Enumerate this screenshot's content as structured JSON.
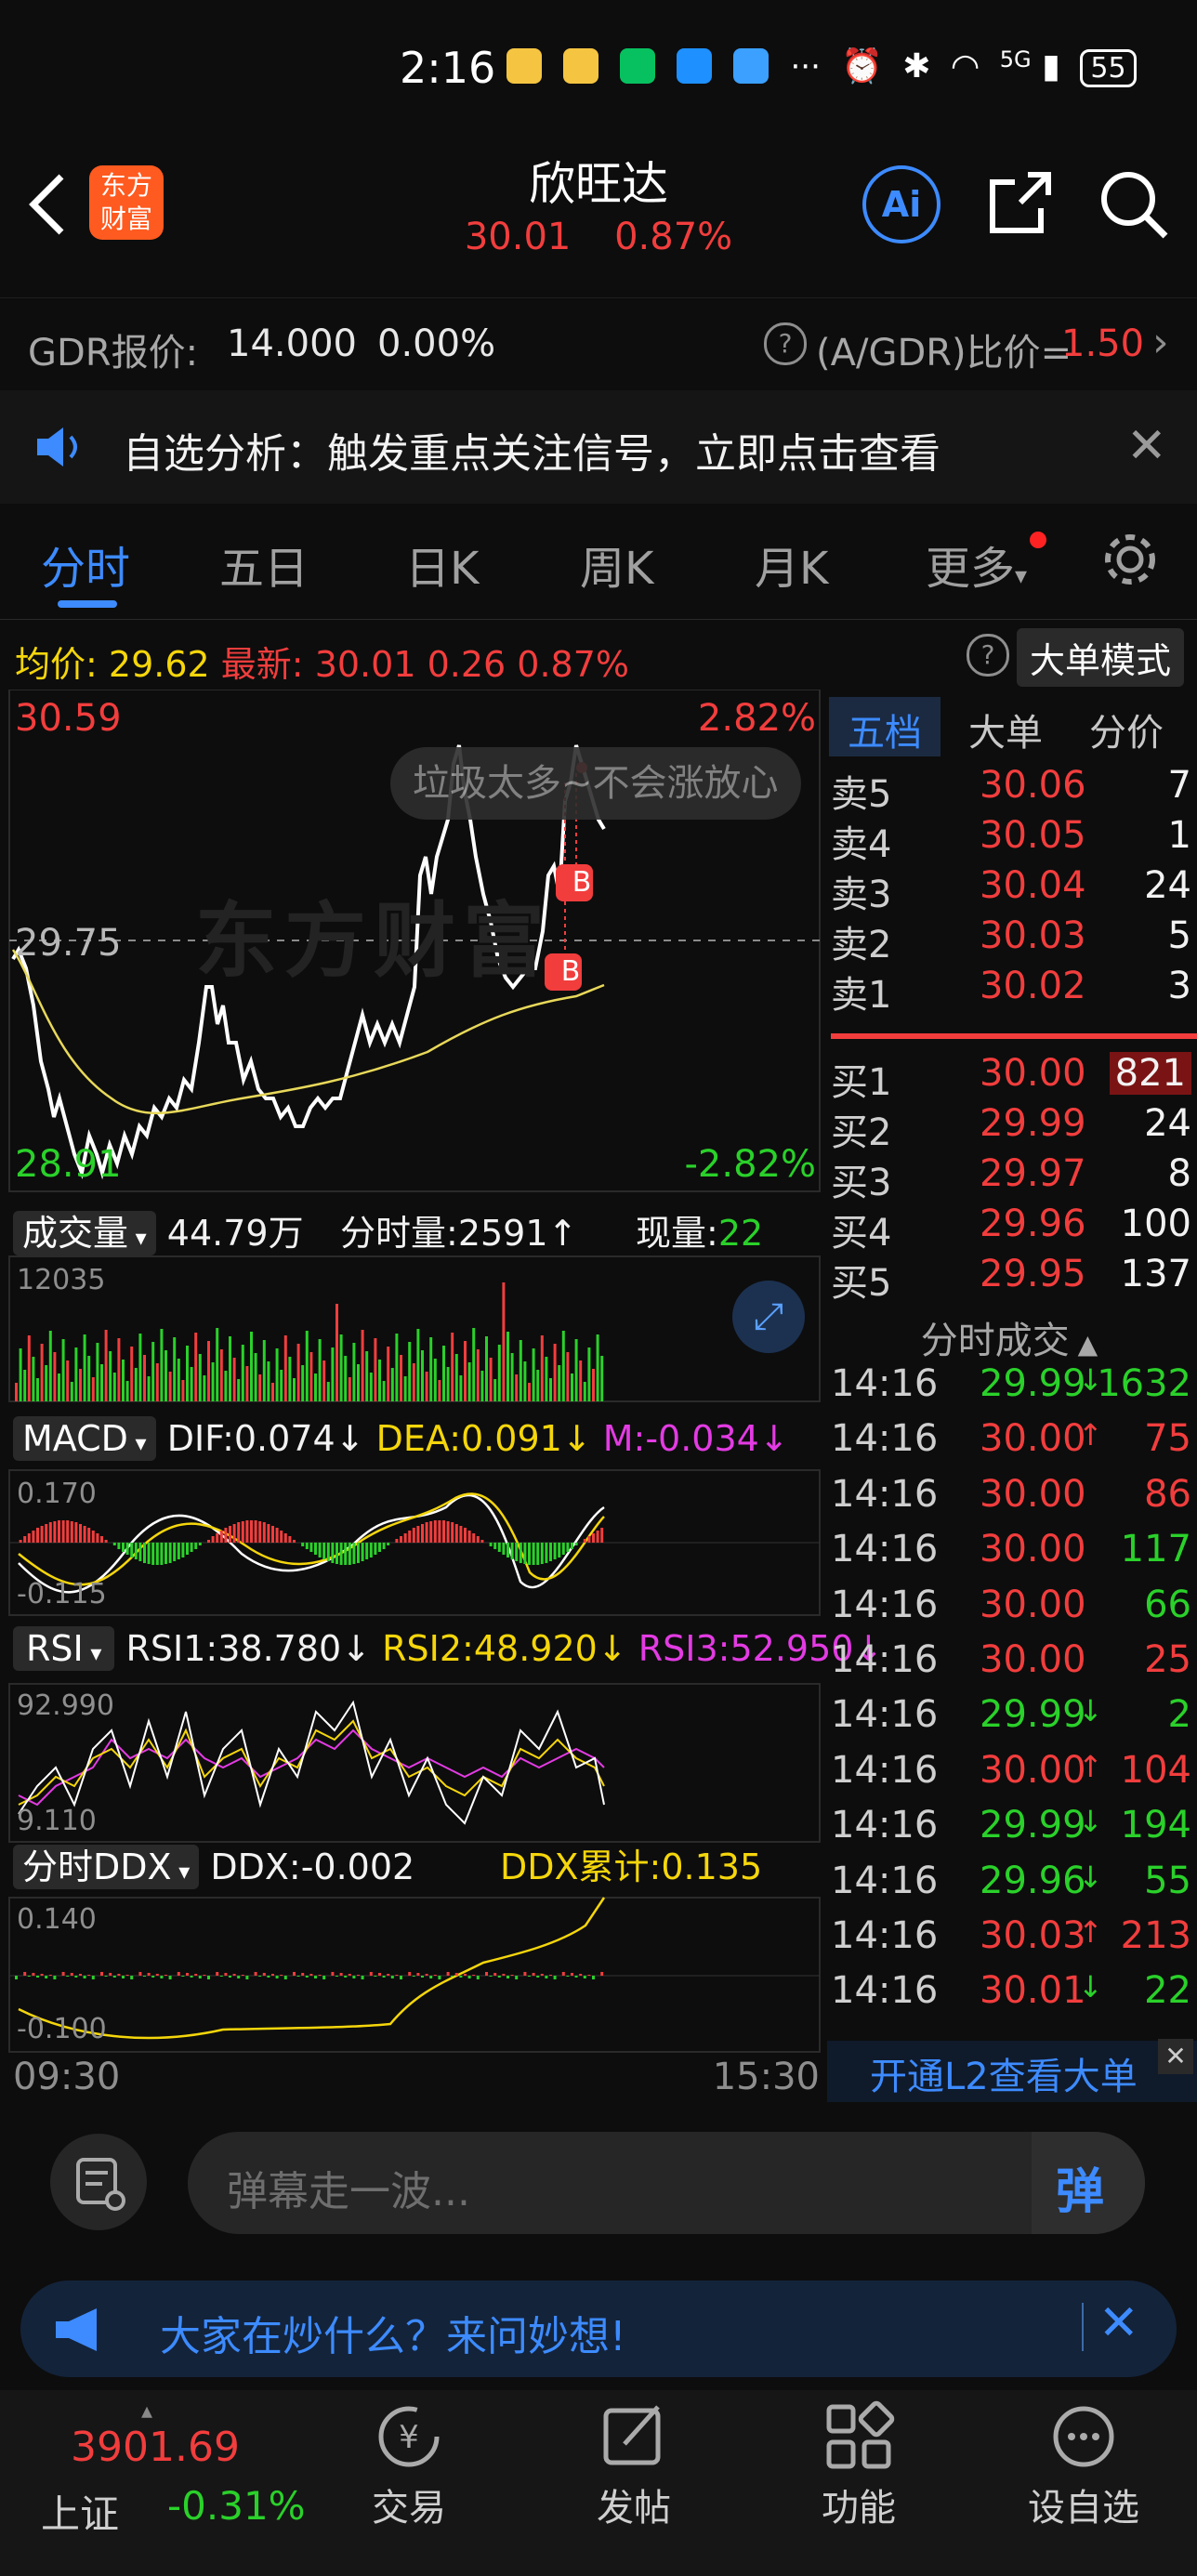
{
  "status_bar": {
    "time": "2:16",
    "more": "···",
    "signal": "5G",
    "battery": "55"
  },
  "header": {
    "logo_line1": "东方",
    "logo_line2": "财富",
    "title": "欣旺达",
    "price": "30.01",
    "change_pct": "0.87%"
  },
  "gdr": {
    "label": "GDR报价:",
    "price": "14.000",
    "pct": "0.00%",
    "ratio_label": "(A/GDR)比价=",
    "ratio_value": "1.50"
  },
  "notice": {
    "text": "自选分析：触发重点关注信号，立即点击查看"
  },
  "tabs": [
    "分时",
    "五日",
    "日K",
    "周K",
    "月K",
    "更多"
  ],
  "info": {
    "avg_label": "均价:",
    "avg_value": "29.62",
    "latest_label": "最新:",
    "latest_value": "30.01",
    "change": "0.26",
    "pct": "0.87%",
    "mode_button": "大单模式"
  },
  "price_chart": {
    "high": "30.59",
    "high_pct": "2.82%",
    "mid": "29.75",
    "low": "28.91",
    "low_pct": "-2.82%",
    "watermark": "东方财富",
    "bubble": "垃圾太多~不会涨放心",
    "markers": [
      "B",
      "B"
    ]
  },
  "volume": {
    "selector": "成交量",
    "total": "44.79万",
    "minute_label": "分时量:",
    "minute_value": "2591",
    "now_label": "现量:",
    "now_value": "22",
    "max": "12035"
  },
  "macd": {
    "selector": "MACD",
    "dif": "DIF:0.074",
    "dea": "DEA:0.091",
    "m": "M:-0.034",
    "top": "0.170",
    "bottom": "-0.115"
  },
  "rsi": {
    "selector": "RSI",
    "rsi1": "RSI1:38.780",
    "rsi2": "RSI2:48.920",
    "rsi3": "RSI3:52.950",
    "top": "92.990",
    "bottom": "9.110"
  },
  "ddx": {
    "selector": "分时DDX",
    "ddx": "DDX:-0.002",
    "cum": "DDX累计:0.135",
    "top": "0.140",
    "bottom": "-0.100"
  },
  "time_axis": {
    "start": "09:30",
    "end": "15:30"
  },
  "side_tabs": [
    "五档",
    "大单",
    "分价"
  ],
  "asks": [
    {
      "label": "卖5",
      "price": "30.06",
      "vol": "7"
    },
    {
      "label": "卖4",
      "price": "30.05",
      "vol": "1"
    },
    {
      "label": "卖3",
      "price": "30.04",
      "vol": "24"
    },
    {
      "label": "卖2",
      "price": "30.03",
      "vol": "5"
    },
    {
      "label": "卖1",
      "price": "30.02",
      "vol": "3"
    }
  ],
  "bids": [
    {
      "label": "买1",
      "price": "30.00",
      "vol": "821"
    },
    {
      "label": "买2",
      "price": "29.99",
      "vol": "24"
    },
    {
      "label": "买3",
      "price": "29.97",
      "vol": "8"
    },
    {
      "label": "买4",
      "price": "29.96",
      "vol": "100"
    },
    {
      "label": "买5",
      "price": "29.95",
      "vol": "137"
    }
  ],
  "trades_title": "分时成交",
  "trades": [
    {
      "time": "14:16",
      "price": "29.99",
      "dir": "down",
      "vol": "1632"
    },
    {
      "time": "14:16",
      "price": "30.00",
      "dir": "up",
      "vol": "75"
    },
    {
      "time": "14:16",
      "price": "30.00",
      "dir": "none",
      "vol": "86"
    },
    {
      "time": "14:16",
      "price": "30.00",
      "dir": "none",
      "vol": "117"
    },
    {
      "time": "14:16",
      "price": "30.00",
      "dir": "none",
      "vol": "66"
    },
    {
      "time": "14:16",
      "price": "30.00",
      "dir": "none",
      "vol": "25"
    },
    {
      "time": "14:16",
      "price": "29.99",
      "dir": "down",
      "vol": "2"
    },
    {
      "time": "14:16",
      "price": "30.00",
      "dir": "up",
      "vol": "104"
    },
    {
      "time": "14:16",
      "price": "29.99",
      "dir": "down",
      "vol": "194"
    },
    {
      "time": "14:16",
      "price": "29.96",
      "dir": "down",
      "vol": "55"
    },
    {
      "time": "14:16",
      "price": "30.03",
      "dir": "up",
      "vol": "213"
    },
    {
      "time": "14:16",
      "price": "30.01",
      "dir": "down",
      "vol": "22"
    }
  ],
  "l2_banner": "开通L2查看大单",
  "danmu": {
    "placeholder": "弹幕走一波...",
    "send": "弹"
  },
  "ask_banner": {
    "text": "大家在炒什么？来问妙想!"
  },
  "bottom_nav": {
    "index_value": "3901.69",
    "index_name": "上证",
    "index_pct": "-0.31%",
    "items": [
      "交易",
      "发帖",
      "功能",
      "设自选"
    ]
  }
}
